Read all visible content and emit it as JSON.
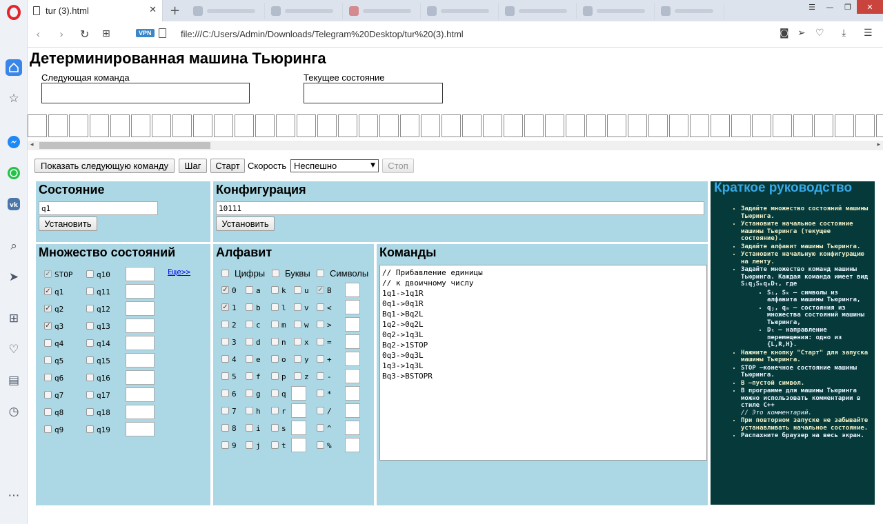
{
  "browser": {
    "tab_title": "tur (3).html",
    "url": "file:///C:/Users/Admin/Downloads/Telegram%20Desktop/tur%20(3).html",
    "vpn_label": "VPN"
  },
  "page": {
    "title": "Детерминированная машина Тьюринга",
    "next_command_label": "Следующая команда",
    "current_state_label": "Текущее состояние"
  },
  "toolbar": {
    "show_next": "Показать следующую команду",
    "step": "Шаг",
    "start": "Старт",
    "speed_label": "Скорость",
    "speed_value": "Неспешно",
    "stop": "Стоп"
  },
  "state_panel": {
    "title": "Состояние",
    "value": "q1",
    "set_button": "Установить"
  },
  "config_panel": {
    "title": "Конфигурация",
    "value": "10111",
    "set_button": "Установить"
  },
  "states_panel": {
    "title": "Множество состояний",
    "more_link": "Еще>>",
    "col1": [
      {
        "label": "STOP",
        "checked": true,
        "disabled": true
      },
      {
        "label": "q1",
        "checked": true
      },
      {
        "label": "q2",
        "checked": true
      },
      {
        "label": "q3",
        "checked": true
      },
      {
        "label": "q4",
        "checked": false
      },
      {
        "label": "q5",
        "checked": false
      },
      {
        "label": "q6",
        "checked": false
      },
      {
        "label": "q7",
        "checked": false
      },
      {
        "label": "q8",
        "checked": false
      },
      {
        "label": "q9",
        "checked": false
      }
    ],
    "col2": [
      "q10",
      "q11",
      "q12",
      "q13",
      "q14",
      "q15",
      "q16",
      "q17",
      "q18",
      "q19"
    ]
  },
  "alphabet_panel": {
    "title": "Алфавит",
    "group_digits": "Цифры",
    "group_letters": "Буквы",
    "group_symbols": "Символы",
    "digits": [
      {
        "c": "0",
        "checked": true
      },
      {
        "c": "1",
        "checked": true
      },
      {
        "c": "2"
      },
      {
        "c": "3"
      },
      {
        "c": "4"
      },
      {
        "c": "5"
      },
      {
        "c": "6"
      },
      {
        "c": "7"
      },
      {
        "c": "8"
      },
      {
        "c": "9"
      }
    ],
    "letters_a": [
      "a",
      "b",
      "c",
      "d",
      "e",
      "f",
      "g",
      "h",
      "i",
      "j"
    ],
    "letters_b": [
      "k",
      "l",
      "m",
      "n",
      "o",
      "p",
      "q",
      "r",
      "s",
      "t"
    ],
    "letters_c": [
      "u",
      "v",
      "w",
      "x",
      "y",
      "z"
    ],
    "symbols": [
      {
        "c": "B",
        "checked": true,
        "disabled": true
      },
      {
        "c": "<"
      },
      {
        "c": ">"
      },
      {
        "c": "="
      },
      {
        "c": "+"
      },
      {
        "c": "-"
      },
      {
        "c": "*"
      },
      {
        "c": "/"
      },
      {
        "c": "^"
      },
      {
        "c": "%"
      }
    ]
  },
  "commands_panel": {
    "title": "Команды",
    "text": "// Прибавление единицы\n// к двоичному числу\n1q1->1q1R\n0q1->0q1R\nBq1->Bq2L\n1q2->0q2L\n0q2->1q3L\nBq2->1STOP\n0q3->0q3L\n1q3->1q3L\nBq3->BSTOPR"
  },
  "guide": {
    "title": "Краткое руководство",
    "items": [
      "Задайте множество состояний машины Тьюринга.",
      "Установите начальное состояние машины Тьюринга (текущее состояние).",
      "Задайте алфавит машины Тьюринга.",
      "Установите начальную конфигурацию на ленту.",
      "Задайте множество команд машины Тьюринга. Каждая команда имеет вид SᵢqⱼSₖqₘDₜ, где",
      "Нажмите кнопку \"Старт\" для запуска машины Тьюринга.",
      "STOP —конечное состояние машины Тьюринга.",
      "B —пустой символ.",
      "В программе для машины Тьюринга можно использовать комментарии в стиле C++",
      "// Это комментарий.",
      "При повторном запуске не забывайте устанавливать начальное состояние.",
      "Распахните браузер на весь экран."
    ],
    "sub_items": [
      "Sᵢ, Sₖ — символы из алфавита машины Тьюринга,",
      "qⱼ, qₘ — состояния из множества состояний машины Тьюринга,",
      "Dₜ — направление перемещения: одно из {L,R,H}."
    ]
  },
  "colors": {
    "panel": "#acd8e5",
    "guide_bg": "#063a3a",
    "guide_title": "#37a9e8",
    "opera_red": "#e1252b"
  }
}
